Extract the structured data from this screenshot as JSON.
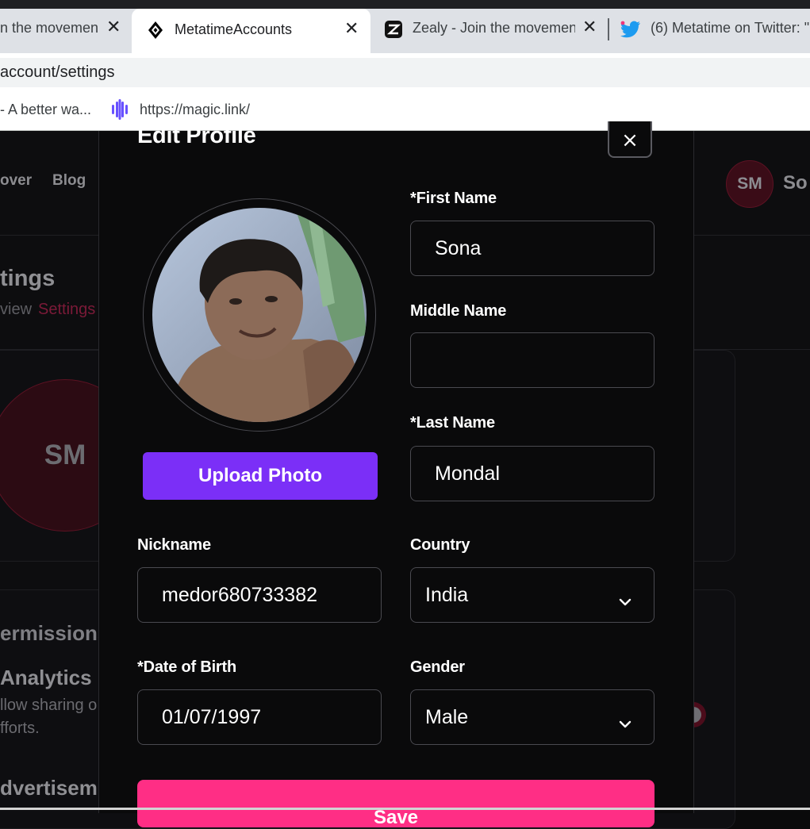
{
  "browser": {
    "tabs": [
      {
        "title": "n the movement",
        "active": false
      },
      {
        "title": "MetatimeAccounts",
        "active": true
      },
      {
        "title": "Zealy - Join the movement",
        "active": false
      },
      {
        "title": "(6) Metatime on Twitter: \"",
        "active": false
      }
    ],
    "close_glyph": "✕",
    "address": "account/settings",
    "bookmarks": [
      {
        "label": "- A better wa..."
      },
      {
        "label": "https://magic.link/"
      }
    ]
  },
  "background": {
    "nav": [
      "over",
      "Blog"
    ],
    "avatar_initials": "SM",
    "username": "So",
    "heading": "tings",
    "breadcrumb": [
      "view",
      "Settings"
    ],
    "profile_initials": "SM",
    "permissions_heading": "ermissions",
    "analytics_title": "Analytics",
    "analytics_desc": "llow sharing o fforts.",
    "advertising_title": "dvertisem"
  },
  "modal": {
    "title": "Edit Profile",
    "close_glyph": "×",
    "upload_label": "Upload Photo",
    "first_name": {
      "label": "*First Name",
      "value": "Sona"
    },
    "middle_name": {
      "label": "Middle Name",
      "value": ""
    },
    "last_name": {
      "label": "*Last Name",
      "value": "Mondal"
    },
    "nickname": {
      "label": "Nickname",
      "value": "medor680733382"
    },
    "country": {
      "label": "Country",
      "value": "India"
    },
    "dob": {
      "label": "*Date of Birth",
      "value": "01/07/1997"
    },
    "gender": {
      "label": "Gender",
      "value": "Male"
    },
    "save_label": "Save"
  },
  "colors": {
    "upload_button": "#7b2ff7",
    "save_button": "#ff2e85",
    "accent_crimson": "#7b1a38"
  }
}
